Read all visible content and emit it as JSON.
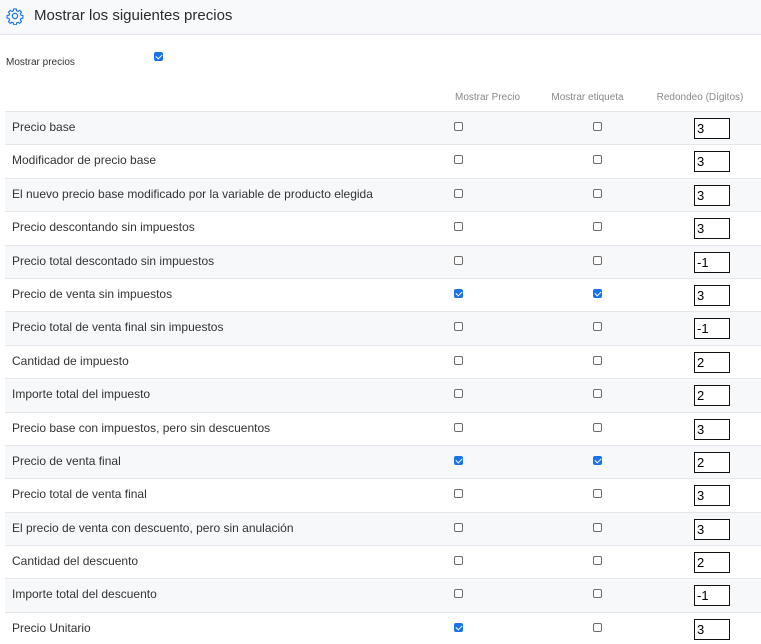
{
  "header": {
    "title": "Mostrar los siguientes precios",
    "icon": "gear-icon",
    "accent": "#1a73e8"
  },
  "show_prices": {
    "label": "Mostrar precios",
    "checked": true
  },
  "columns": {
    "show_price": "Mostrar Precio",
    "show_label": "Mostrar etiqueta",
    "rounding": "Redondeo (Dígitos)"
  },
  "rows": [
    {
      "label": "Precio base",
      "show_price": false,
      "show_label": false,
      "digits": "3"
    },
    {
      "label": "Modificador de precio base",
      "show_price": false,
      "show_label": false,
      "digits": "3"
    },
    {
      "label": "El nuevo precio base modificado por la variable de producto elegida",
      "show_price": false,
      "show_label": false,
      "digits": "3"
    },
    {
      "label": "Precio descontando sin impuestos",
      "show_price": false,
      "show_label": false,
      "digits": "3"
    },
    {
      "label": "Precio total descontado sin impuestos",
      "show_price": false,
      "show_label": false,
      "digits": "-1"
    },
    {
      "label": "Precio de venta sin impuestos",
      "show_price": true,
      "show_label": true,
      "digits": "3"
    },
    {
      "label": "Precio total de venta final sin impuestos",
      "show_price": false,
      "show_label": false,
      "digits": "-1"
    },
    {
      "label": "Cantidad de impuesto",
      "show_price": false,
      "show_label": false,
      "digits": "2"
    },
    {
      "label": "Importe total del impuesto",
      "show_price": false,
      "show_label": false,
      "digits": "2"
    },
    {
      "label": "Precio base con impuestos, pero sin descuentos",
      "show_price": false,
      "show_label": false,
      "digits": "3"
    },
    {
      "label": "Precio de venta final",
      "show_price": true,
      "show_label": true,
      "digits": "2"
    },
    {
      "label": "Precio total de venta final",
      "show_price": false,
      "show_label": false,
      "digits": "3"
    },
    {
      "label": "El precio de venta con descuento, pero sin anulación",
      "show_price": false,
      "show_label": false,
      "digits": "3"
    },
    {
      "label": "Cantidad del descuento",
      "show_price": false,
      "show_label": false,
      "digits": "2"
    },
    {
      "label": "Importe total del descuento",
      "show_price": false,
      "show_label": false,
      "digits": "-1"
    },
    {
      "label": "Precio Unitario",
      "show_price": true,
      "show_label": false,
      "digits": "3"
    }
  ]
}
